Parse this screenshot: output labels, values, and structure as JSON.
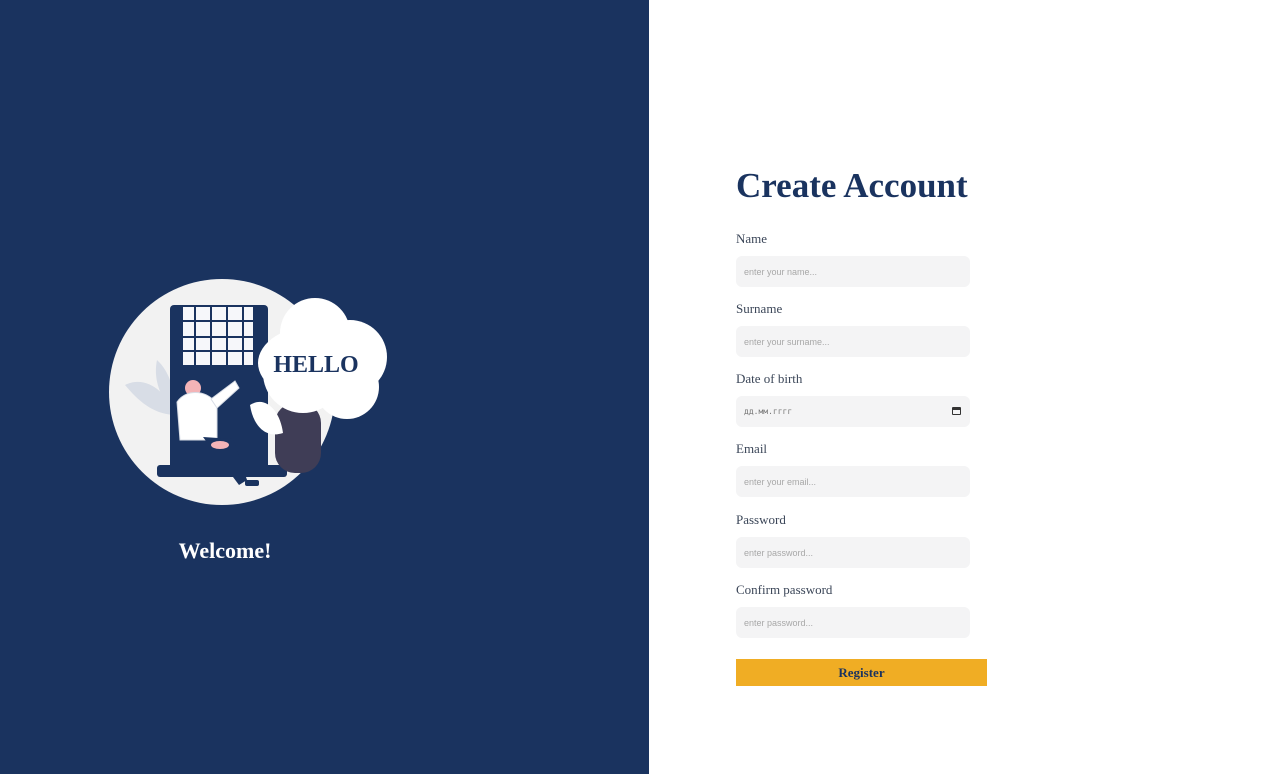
{
  "welcome": {
    "illustration_text": "HELLO",
    "title": "Welcome!"
  },
  "form": {
    "title": "Create Account",
    "fields": [
      {
        "label": "Name",
        "placeholder": "enter your name..."
      },
      {
        "label": "Surname",
        "placeholder": "enter your surname..."
      },
      {
        "label": "Date of birth",
        "value": "дд.мм.гггг",
        "icon": "calendar-icon"
      },
      {
        "label": "Email",
        "placeholder": "enter your email..."
      },
      {
        "label": "Password",
        "placeholder": "enter password..."
      },
      {
        "label": "Confirm password",
        "placeholder": "enter password..."
      }
    ],
    "submit_label": "Register"
  },
  "colors": {
    "left_panel": "#1a335f",
    "accent": "#f0ad24",
    "input_bg": "#f4f4f5"
  }
}
